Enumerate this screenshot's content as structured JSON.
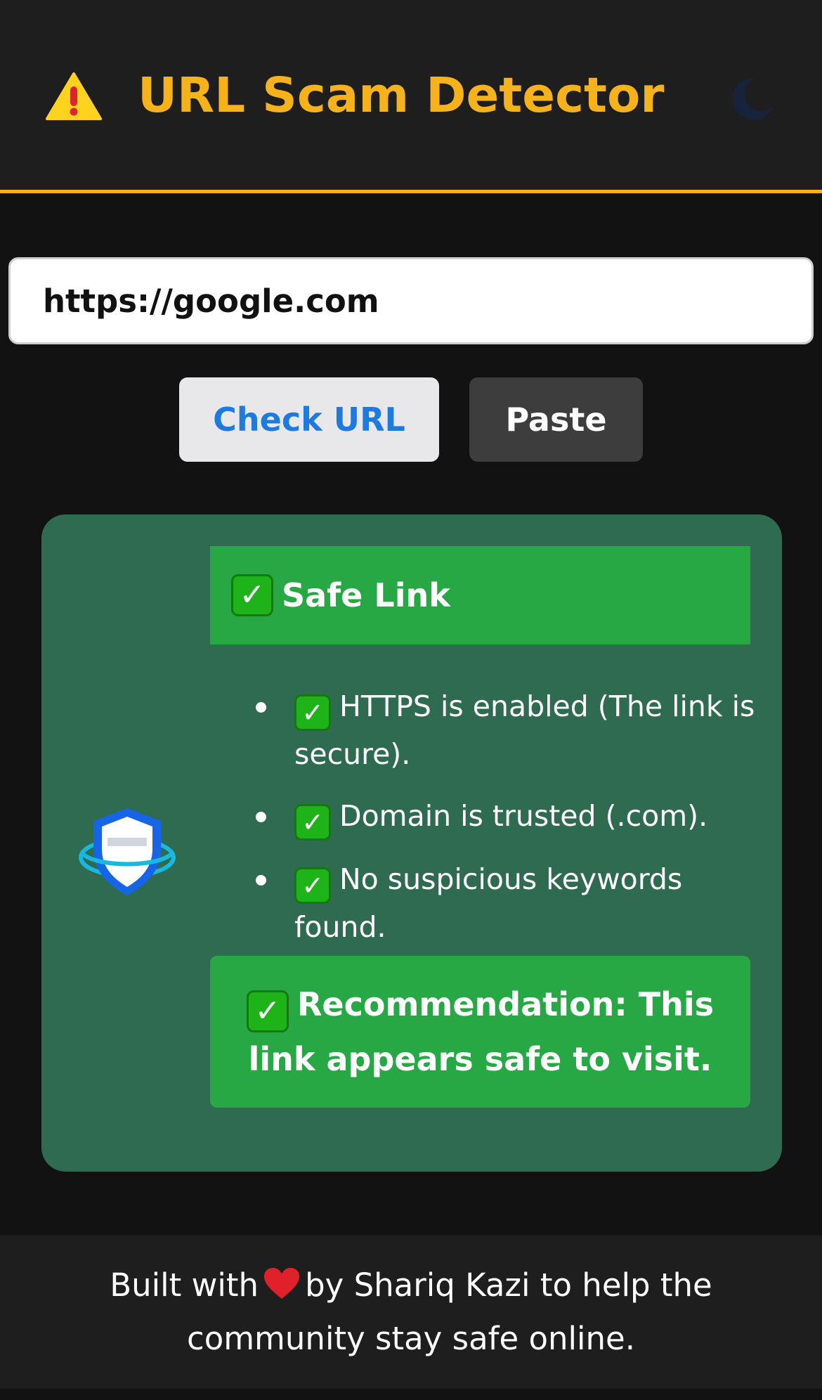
{
  "header": {
    "title": "URL Scam Detector",
    "warning_icon": "warning-triangle-icon",
    "theme_toggle_icon": "moon-icon",
    "accent_color": "#f5b21b"
  },
  "input": {
    "value": "https://google.com",
    "placeholder": ""
  },
  "buttons": {
    "check_label": "Check URL",
    "paste_label": "Paste"
  },
  "result": {
    "status_icon": "shield-icon",
    "verdict_label": "Safe Link",
    "reasons": [
      "HTTPS is enabled (The link is secure).",
      "Domain is trusted (.com).",
      "No suspicious keywords found."
    ],
    "recommendation": "Recommendation: This link appears safe to visit.",
    "card_color": "#2f6b50",
    "safe_color": "#28a745"
  },
  "footer": {
    "text_before": "Built with",
    "heart_icon": "heart-icon",
    "text_after": "by Shariq Kazi to help the community stay safe online."
  }
}
